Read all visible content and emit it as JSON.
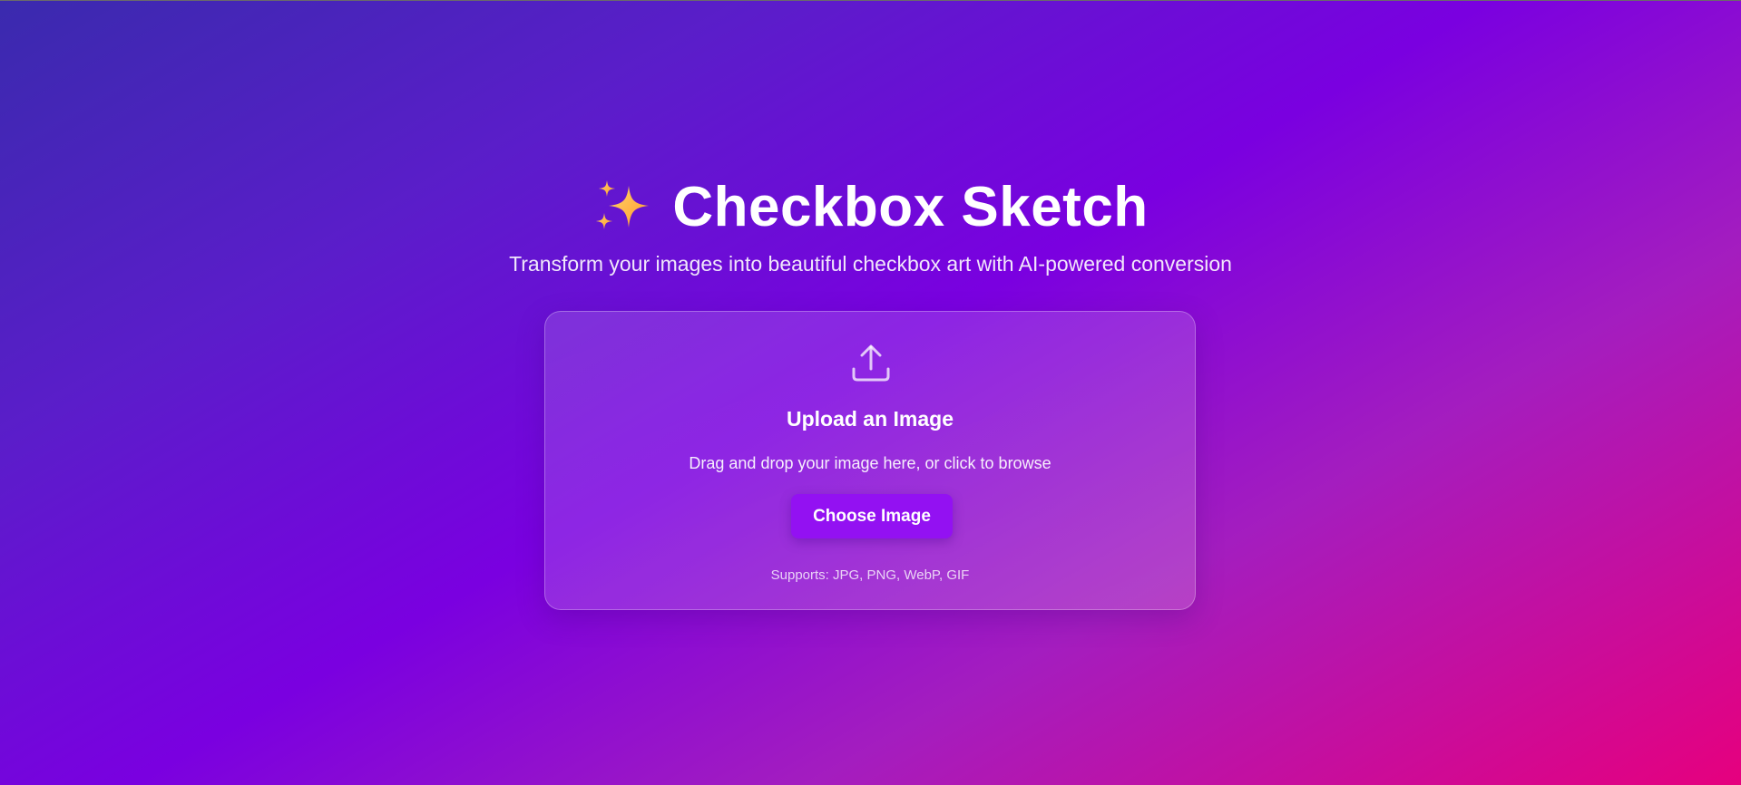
{
  "header": {
    "icon": "sparkles-icon",
    "title": "Checkbox Sketch",
    "subtitle": "Transform your images into beautiful checkbox art with AI-powered conversion"
  },
  "upload": {
    "icon": "upload-icon",
    "title": "Upload an Image",
    "description": "Drag and drop your image here, or click to browse",
    "button_label": "Choose Image",
    "supports_text": "Supports: JPG, PNG, WebP, GIF"
  },
  "colors": {
    "button": "#9311f2",
    "gradient_start": "#3a2aae",
    "gradient_mid": "#7a00e0",
    "gradient_end": "#e6007e"
  }
}
